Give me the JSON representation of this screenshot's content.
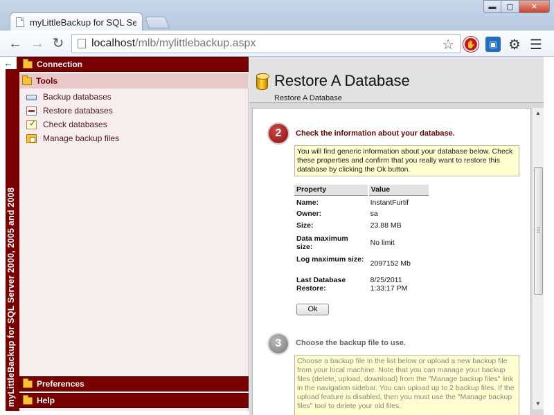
{
  "browser": {
    "tab_title": "myLittleBackup for SQL Se",
    "url_host": "localhost",
    "url_path": "/mlb/mylittlebackup.aspx",
    "window_controls": {
      "minimize": "▬",
      "maximize": "▢",
      "close": "✕"
    }
  },
  "sidebar": {
    "vertical_title": "myLittleBackup for SQL Server 2000, 2005 and 2008",
    "sections": {
      "connection": "Connection",
      "tools": "Tools",
      "preferences": "Preferences",
      "help": "Help"
    },
    "tools": [
      {
        "label": "Backup databases",
        "icon": "backup-icon"
      },
      {
        "label": "Restore databases",
        "icon": "restore-icon"
      },
      {
        "label": "Check databases",
        "icon": "check-icon"
      },
      {
        "label": "Manage backup files",
        "icon": "manage-files-icon"
      }
    ]
  },
  "main": {
    "title": "Restore A Database",
    "breadcrumb": "Restore A Database",
    "step2": {
      "number": "2",
      "title": "Check the information about your database.",
      "info": "You will find generic information about your database below. Check these properties and confirm that you really want to restore this database by clicking the Ok button.",
      "table": {
        "headers": [
          "Property",
          "Value"
        ],
        "rows": [
          {
            "name": "Name:",
            "value": "InstantFurtif"
          },
          {
            "name": "Owner:",
            "value": "sa"
          },
          {
            "name": "Size:",
            "value": "23.88 MB"
          },
          {
            "name": "Data maximum size:",
            "value": "No limit"
          },
          {
            "name": "Log maximum size:",
            "value": "2097152 Mb"
          },
          {
            "name": "Last Database Restore:",
            "value": "8/25/2011 1:33:17 PM"
          }
        ]
      },
      "ok_label": "Ok"
    },
    "step3": {
      "number": "3",
      "title": "Choose the backup file to use.",
      "info": "Choose a backup file in the list below or upload a new backup file from your local machine. Note that you can manage your backup files (delete, upload, download) from the \"Manage backup files\" link in the navigation sidebar. You can upload up to 2 backup files. If the upload feature is disabled, then you must use the \"Manage backup files\" tool to delete your old files."
    }
  },
  "colors": {
    "accent": "#7a0000",
    "info_bg": "#ffffcf"
  }
}
